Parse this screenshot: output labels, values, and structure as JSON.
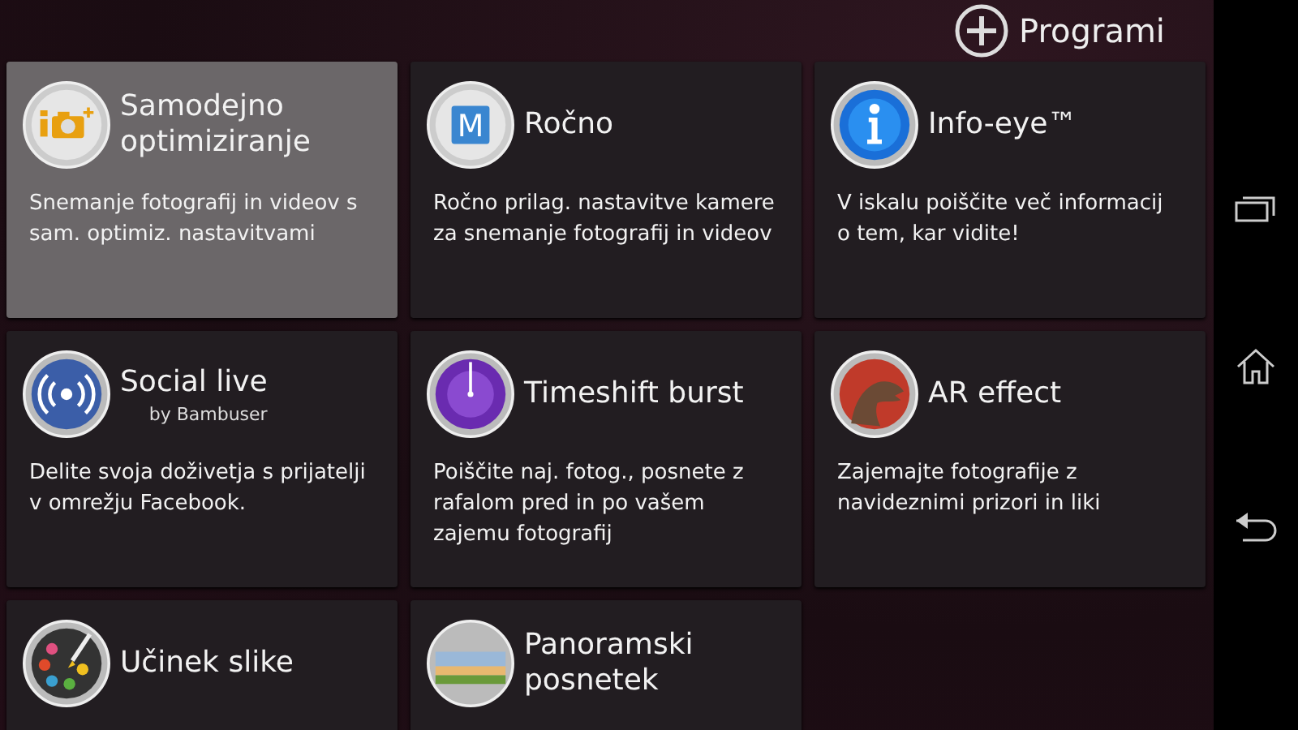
{
  "header": {
    "add_button": {
      "label": "Programi"
    }
  },
  "tiles": [
    {
      "title": "Samodejno optimiziranje",
      "description": "Snemanje fotografij in videov s sam. optimiz. nastavitvami",
      "selected": true
    },
    {
      "icon_label": "M",
      "title": "Ročno",
      "description": "Ročno prilag. nastavitve kamere za snemanje fotografij in videov",
      "selected": false
    },
    {
      "title": "Info-eye™",
      "description": "V iskalu poiščite več informacij o tem, kar vidite!",
      "selected": false
    },
    {
      "title": "Social live",
      "subtitle": "by Bambuser",
      "description": "Delite svoja doživetja s prijatelji v omrežju Facebook.",
      "selected": false
    },
    {
      "title": "Timeshift burst",
      "description": "Poiščite naj. fotog., posnete z rafalom pred in po vašem zajemu fotografij",
      "selected": false
    },
    {
      "title": "AR effect",
      "description": "Zajemajte fotografije z navideznimi prizori in liki",
      "selected": false
    },
    {
      "title": "Učinek slike",
      "selected": false
    },
    {
      "title": "Panoramski posnetek",
      "selected": false
    }
  ]
}
